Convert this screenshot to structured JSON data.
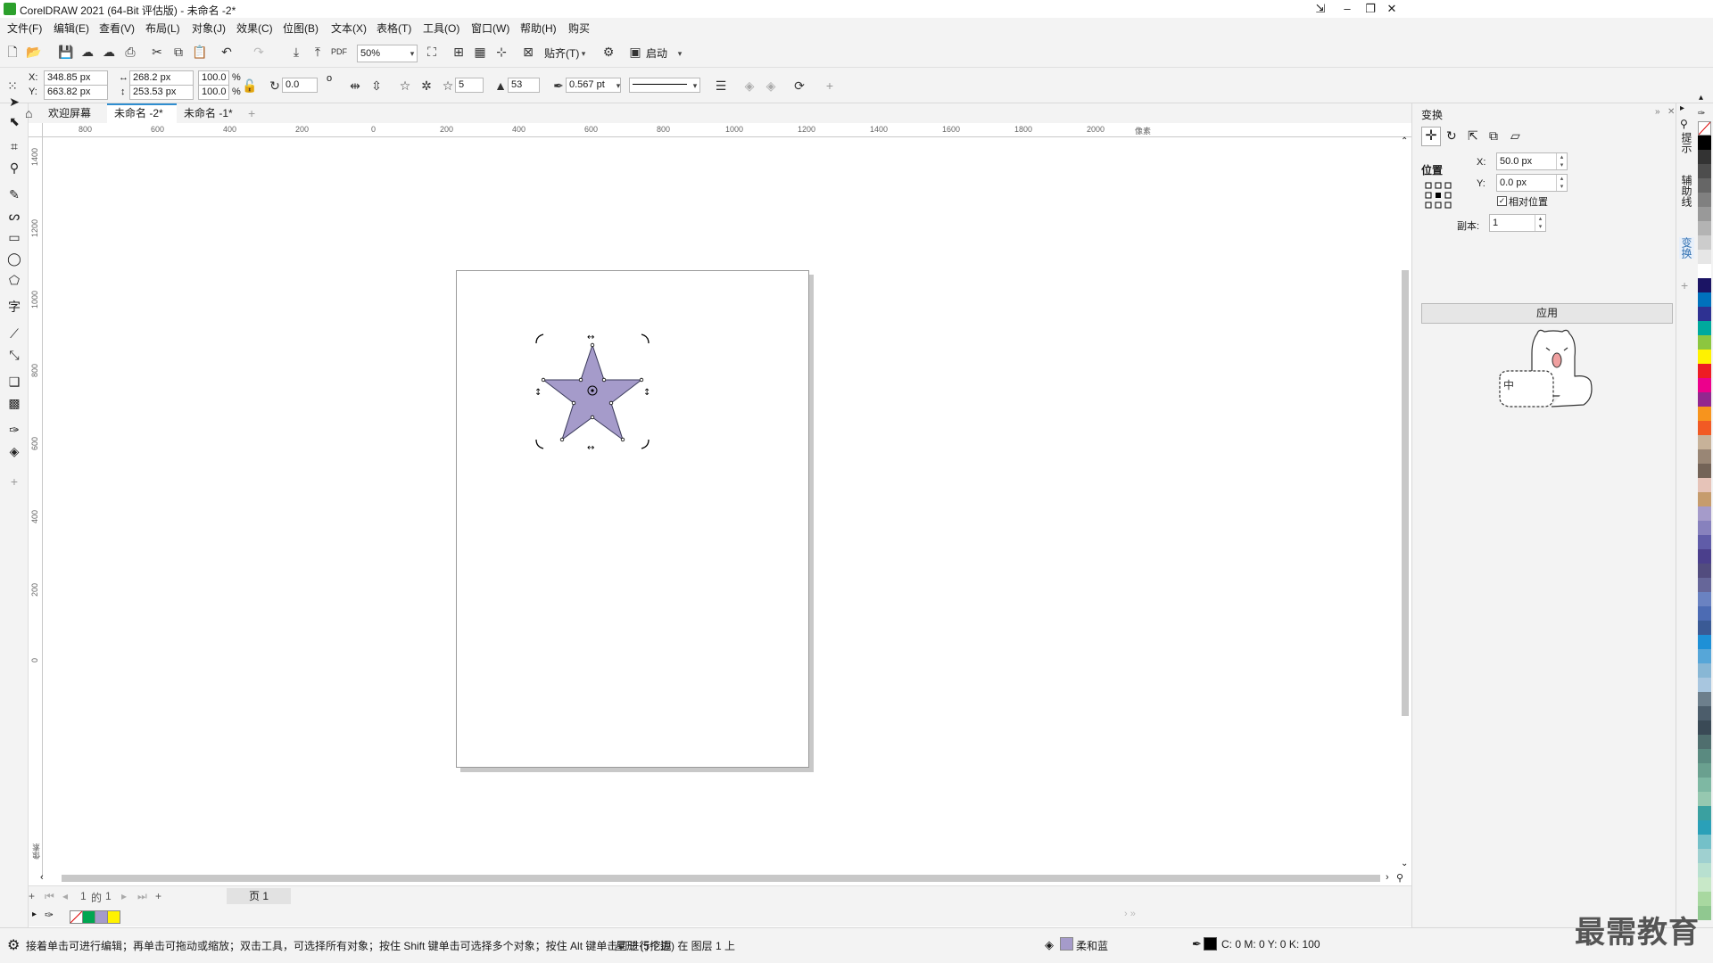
{
  "titlebar": {
    "title": "CorelDRAW 2021 (64-Bit 评估版) - 未命名 -2*"
  },
  "menu": [
    "文件(F)",
    "编辑(E)",
    "查看(V)",
    "布局(L)",
    "对象(J)",
    "效果(C)",
    "位图(B)",
    "文本(X)",
    "表格(T)",
    "工具(O)",
    "窗口(W)",
    "帮助(H)",
    "购买"
  ],
  "toolbar": {
    "zoom": "50%",
    "snap_label": "贴齐(T)",
    "launch_label": "启动"
  },
  "propbar": {
    "x_label": "X:",
    "x_value": "348.85 px",
    "y_label": "Y:",
    "y_value": "663.82 px",
    "width_value": "268.2 px",
    "height_value": "253.53 px",
    "scale_w": "100.0",
    "scale_h": "100.0",
    "percent": "%",
    "rotation": "0.0",
    "degree": "o",
    "points": "5",
    "sharpness": "53",
    "outline_width": "0.567 pt"
  },
  "tabs": [
    "欢迎屏幕",
    "未命名 -2*",
    "未命名 -1*"
  ],
  "ruler": {
    "h_ticks": [
      "800",
      "600",
      "400",
      "200",
      "0",
      "200",
      "400",
      "600",
      "800",
      "1000",
      "1200",
      "1400",
      "1600",
      "1800",
      "2000"
    ],
    "h_unit": "像素",
    "v_ticks": [
      "1400",
      "1200",
      "1000",
      "800",
      "600",
      "400",
      "200",
      "0"
    ],
    "v_unit": "像素"
  },
  "star": {
    "fill": "#a59bca",
    "stroke": "#3a3a5a"
  },
  "pagenav": {
    "current": "1",
    "of": "的",
    "total": "1",
    "page_tab": "页 1"
  },
  "doc_palette": [
    "#00a651",
    "#a59bca",
    "#fff200"
  ],
  "status": {
    "hint": "接着单击可进行编辑；再单击可拖动或缩放；双击工具，可选择所有对象；按住 Shift 键单击可选择多个对象；按住 Alt 键单击可进行挖掘",
    "object": "星形 (5个边) 在 图层 1 上",
    "fill_name": "柔和蓝",
    "fill_color": "#a59bca",
    "cmyk": "C: 0 M: 0 Y: 0 K: 100"
  },
  "docker": {
    "title": "变换",
    "section": "位置",
    "x_label": "X:",
    "x_value": "50.0 px",
    "y_label": "Y:",
    "y_value": "0.0 px",
    "relative_label": "相对位置",
    "relative_checked": true,
    "copies_label": "副本:",
    "copies_value": "1",
    "apply_label": "应用"
  },
  "side_tabs": [
    "提示",
    "辅助线",
    "变换"
  ],
  "mascot_text": "中",
  "watermark": "最需教育",
  "palette_colors": [
    "#ffffff",
    "#000000",
    "#333333",
    "#4d4d4d",
    "#666666",
    "#808080",
    "#999999",
    "#b3b3b3",
    "#cccccc",
    "#e6e6e6",
    "#ffffff",
    "#1b1464",
    "#0071bc",
    "#2e3192",
    "#00a99d",
    "#8cc63f",
    "#fff200",
    "#ed1c24",
    "#ec008c",
    "#92278f",
    "#f7941d",
    "#f15a24",
    "#c7b299",
    "#998675",
    "#736357",
    "#e6c3b8",
    "#c69c6d",
    "#a59bca",
    "#8781bd",
    "#605ca8",
    "#4b3f8c",
    "#524c7e",
    "#666699",
    "#6a82c1",
    "#4c6bb3",
    "#3a5a95",
    "#1e90d6",
    "#56a6d8",
    "#88b7d5",
    "#a8c6df",
    "#6d7f8c",
    "#4c5d6b",
    "#3a4a56",
    "#4f6e6e",
    "#5a8a80",
    "#6aa08f",
    "#7eb8a3",
    "#96c8b0",
    "#3aa0a0",
    "#2aa0b8",
    "#74c0c8",
    "#9fd0d0",
    "#b8e0d0",
    "#c8e8c8",
    "#a8d8a0",
    "#90c890"
  ]
}
